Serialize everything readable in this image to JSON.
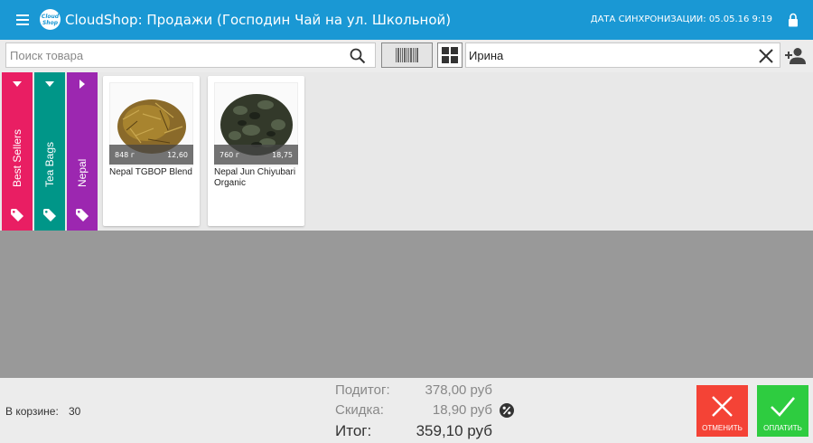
{
  "header": {
    "logo_line1": "Cloud",
    "logo_line2": "Shop",
    "title": "CloudShop: Продажи (Господин Чай на ул. Школьной)",
    "sync": "ДАТА СИНХРОНИЗАЦИИ: 05.05.16 9:19",
    "icons": [
      "menu-icon",
      "lock-icon"
    ]
  },
  "toolbar": {
    "search_placeholder": "Поиск товара",
    "search_value": "",
    "customer": "Ирина",
    "icons": [
      "search-icon",
      "barcode-icon",
      "grid-icon",
      "close-icon",
      "add-person-icon"
    ]
  },
  "categories": [
    {
      "label": "Best Sellers",
      "color": "#e91e63"
    },
    {
      "label": "Tea Bags",
      "color": "#009688"
    },
    {
      "label": "Nepal",
      "color": "#9c27b0"
    }
  ],
  "products": [
    {
      "name": "Nepal TGBOP Blend",
      "weight": "848 г",
      "price": "12,60"
    },
    {
      "name": "Nepal Jun Chiyubari Organic",
      "weight": "760 г",
      "price": "18,75"
    }
  ],
  "footer": {
    "cart_label": "В корзине:",
    "cart_count": "30",
    "subtotal_label": "Подитог:",
    "subtotal_value": "378,00 руб",
    "discount_label": "Скидка:",
    "discount_value": "18,90 руб",
    "total_label": "Итог:",
    "total_value": "359,10 руб",
    "cancel_label": "ОТМЕНИТЬ",
    "pay_label": "ОПЛАТИТЬ",
    "cancel_color": "#f44336",
    "pay_color": "#2ecc40"
  },
  "colors": {
    "header": "#1a98d4",
    "workspace": "#999999"
  }
}
